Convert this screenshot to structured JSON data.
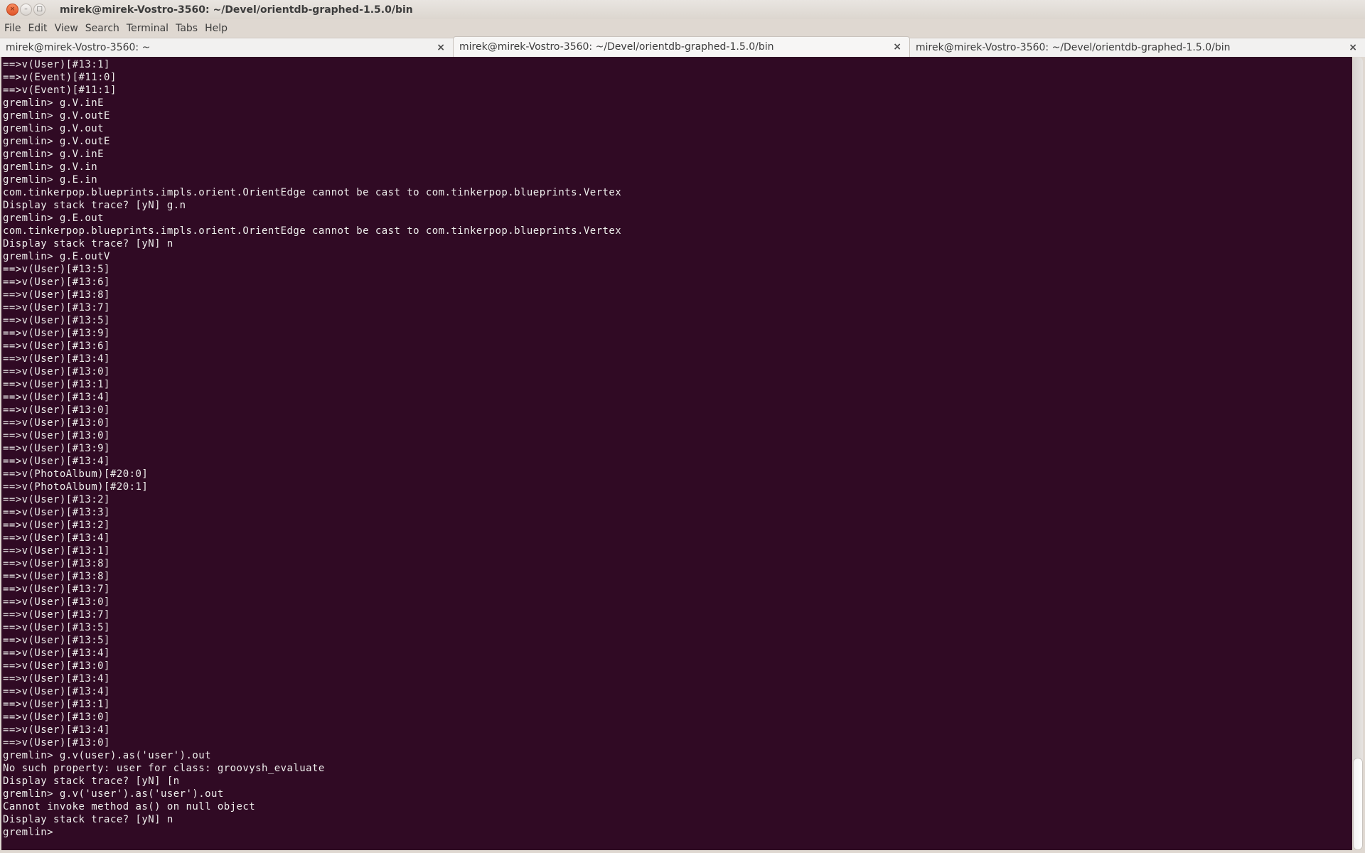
{
  "window": {
    "title": "mirek@mirek-Vostro-3560: ~/Devel/orientdb-graphed-1.5.0/bin",
    "buttons": {
      "close_icon": "×",
      "minimize_icon": "–",
      "maximize_icon": "□"
    }
  },
  "menu": {
    "items": [
      "File",
      "Edit",
      "View",
      "Search",
      "Terminal",
      "Tabs",
      "Help"
    ]
  },
  "tabs": [
    {
      "label": "mirek@mirek-Vostro-3560: ~",
      "active": false,
      "close_icon": "×"
    },
    {
      "label": "mirek@mirek-Vostro-3560: ~/Devel/orientdb-graphed-1.5.0/bin",
      "active": true,
      "close_icon": "×"
    },
    {
      "label": "mirek@mirek-Vostro-3560: ~/Devel/orientdb-graphed-1.5.0/bin",
      "active": false,
      "close_icon": "×"
    }
  ],
  "terminal": {
    "colors": {
      "background": "#300a24",
      "foreground": "#eeeeec"
    },
    "lines": [
      "==>v(User)[#13:1]",
      "==>v(Event)[#11:0]",
      "==>v(Event)[#11:1]",
      "gremlin> g.V.inE",
      "gremlin> g.V.outE",
      "gremlin> g.V.out",
      "gremlin> g.V.outE",
      "gremlin> g.V.inE",
      "gremlin> g.V.in",
      "gremlin> g.E.in",
      "com.tinkerpop.blueprints.impls.orient.OrientEdge cannot be cast to com.tinkerpop.blueprints.Vertex",
      "Display stack trace? [yN] g.n",
      "gremlin> g.E.out",
      "com.tinkerpop.blueprints.impls.orient.OrientEdge cannot be cast to com.tinkerpop.blueprints.Vertex",
      "Display stack trace? [yN] n",
      "gremlin> g.E.outV",
      "==>v(User)[#13:5]",
      "==>v(User)[#13:6]",
      "==>v(User)[#13:8]",
      "==>v(User)[#13:7]",
      "==>v(User)[#13:5]",
      "==>v(User)[#13:9]",
      "==>v(User)[#13:6]",
      "==>v(User)[#13:4]",
      "==>v(User)[#13:0]",
      "==>v(User)[#13:1]",
      "==>v(User)[#13:4]",
      "==>v(User)[#13:0]",
      "==>v(User)[#13:0]",
      "==>v(User)[#13:0]",
      "==>v(User)[#13:9]",
      "==>v(User)[#13:4]",
      "==>v(PhotoAlbum)[#20:0]",
      "==>v(PhotoAlbum)[#20:1]",
      "==>v(User)[#13:2]",
      "==>v(User)[#13:3]",
      "==>v(User)[#13:2]",
      "==>v(User)[#13:4]",
      "==>v(User)[#13:1]",
      "==>v(User)[#13:8]",
      "==>v(User)[#13:8]",
      "==>v(User)[#13:7]",
      "==>v(User)[#13:0]",
      "==>v(User)[#13:7]",
      "==>v(User)[#13:5]",
      "==>v(User)[#13:5]",
      "==>v(User)[#13:4]",
      "==>v(User)[#13:0]",
      "==>v(User)[#13:4]",
      "==>v(User)[#13:4]",
      "==>v(User)[#13:1]",
      "==>v(User)[#13:0]",
      "==>v(User)[#13:4]",
      "==>v(User)[#13:0]",
      "gremlin> g.v(user).as('user').out",
      "No such property: user for class: groovysh_evaluate",
      "Display stack trace? [yN] [n",
      "gremlin> g.v('user').as('user').out",
      "Cannot invoke method as() on null object",
      "Display stack trace? [yN] n",
      "gremlin> "
    ],
    "scroll_position": "bottom"
  }
}
